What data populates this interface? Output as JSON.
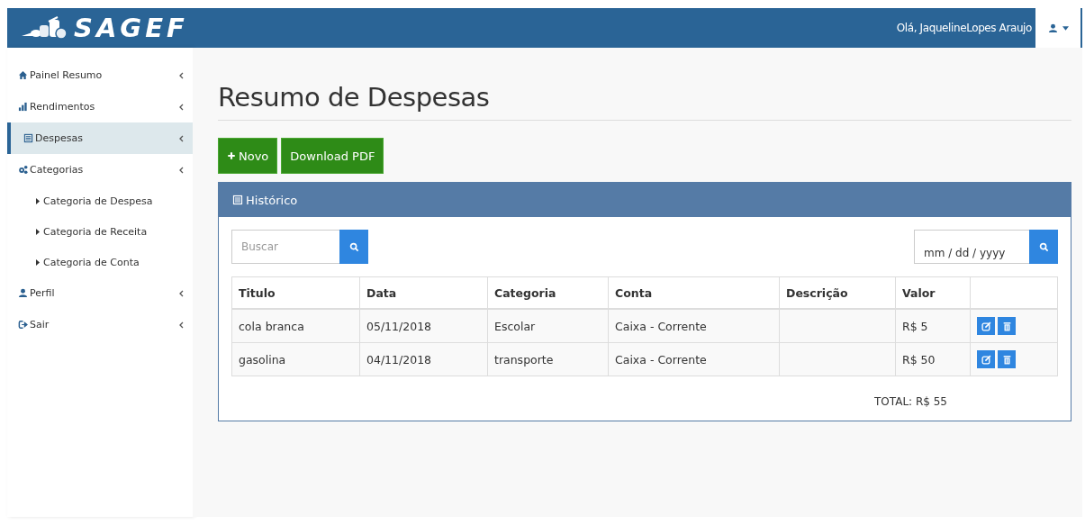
{
  "header": {
    "brand": "SAGEF",
    "greeting": "Olá, JaquelineLopes Araujo"
  },
  "sidebar": {
    "items": [
      {
        "label": "Painel Resumo",
        "selected": false
      },
      {
        "label": "Rendimentos",
        "selected": false
      },
      {
        "label": "Despesas",
        "selected": true
      },
      {
        "label": "Categorias",
        "selected": false,
        "children": [
          {
            "label": "Categoria de Despesa"
          },
          {
            "label": "Categoria de Receita"
          },
          {
            "label": "Categoria de Conta"
          }
        ]
      },
      {
        "label": "Perfil",
        "selected": false
      },
      {
        "label": "Sair",
        "selected": false
      }
    ]
  },
  "page_title": "Resumo de Despesas",
  "buttons": [
    {
      "label": "Novo"
    },
    {
      "label": "Download PDF"
    }
  ],
  "panel": {
    "title": "Histórico",
    "search": {
      "placeholder": "Buscar"
    },
    "date_filter": {
      "placeholder": "mm / dd / yyyy"
    },
    "table": {
      "columns": [
        "Titulo",
        "Data",
        "Categoria",
        "Conta",
        "Descrição",
        "Valor"
      ],
      "rows": [
        {
          "cells": [
            "cola branca",
            "05/11/2018",
            "Escolar",
            "Caixa - Corrente",
            "",
            "R$ 5"
          ]
        },
        {
          "cells": [
            "gasolina",
            "04/11/2018",
            "transporte",
            "Caixa - Corrente",
            "",
            "R$ 50"
          ]
        }
      ]
    },
    "total": "TOTAL: R$ 55"
  }
}
